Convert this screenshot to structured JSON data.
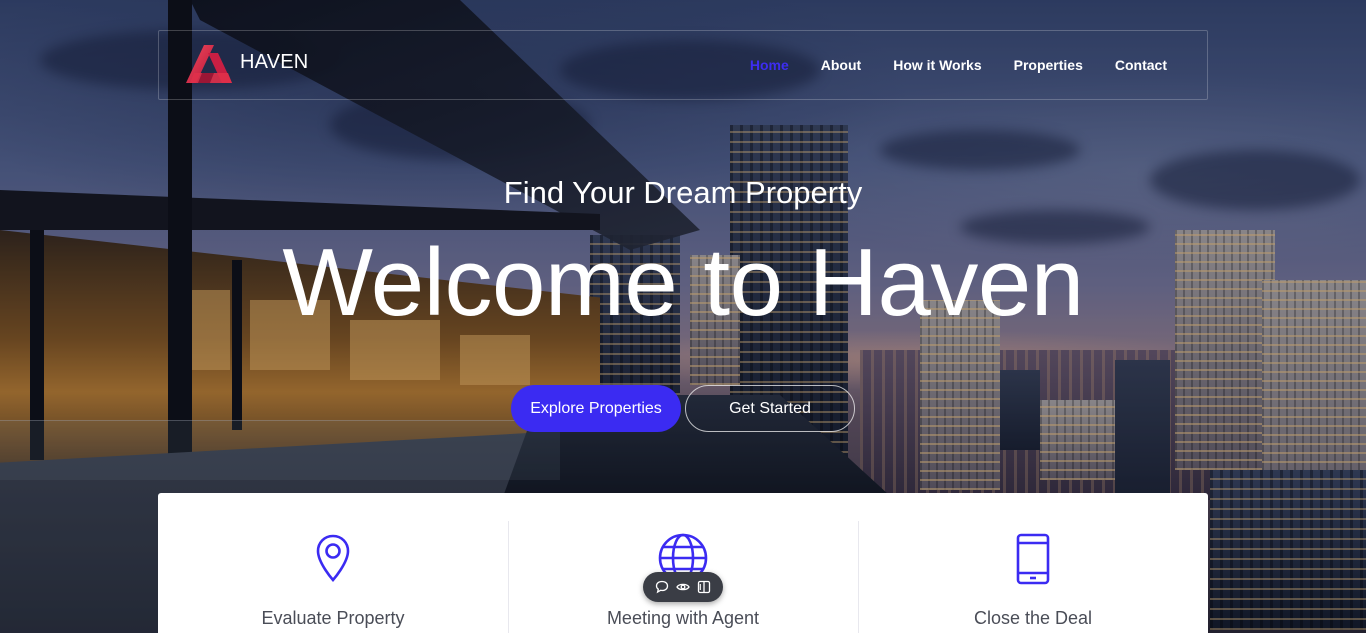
{
  "brand": {
    "name": "HAVEN",
    "logo_icon": "triangle-logo-icon"
  },
  "nav": {
    "items": [
      {
        "label": "Home",
        "active": true
      },
      {
        "label": "About",
        "active": false
      },
      {
        "label": "How it Works",
        "active": false
      },
      {
        "label": "Properties",
        "active": false
      },
      {
        "label": "Contact",
        "active": false
      }
    ]
  },
  "hero": {
    "subtitle": "Find Your Dream Property",
    "title": "Welcome to Haven",
    "primary_cta": "Explore Properties",
    "secondary_cta": "Get Started"
  },
  "features": [
    {
      "title": "Evaluate Property",
      "icon": "location-pin-icon"
    },
    {
      "title": "Meeting with Agent",
      "icon": "globe-icon"
    },
    {
      "title": "Close the Deal",
      "icon": "smartphone-icon"
    }
  ],
  "toolbar": {
    "icons": [
      "comment-icon",
      "eye-icon",
      "split-view-icon"
    ]
  },
  "colors": {
    "accent": "#3b2bf2",
    "nav_active": "#3d2df0",
    "logo_red": "#e0304a",
    "feature_text": "#4a4d57",
    "card_bg": "#ffffff"
  }
}
